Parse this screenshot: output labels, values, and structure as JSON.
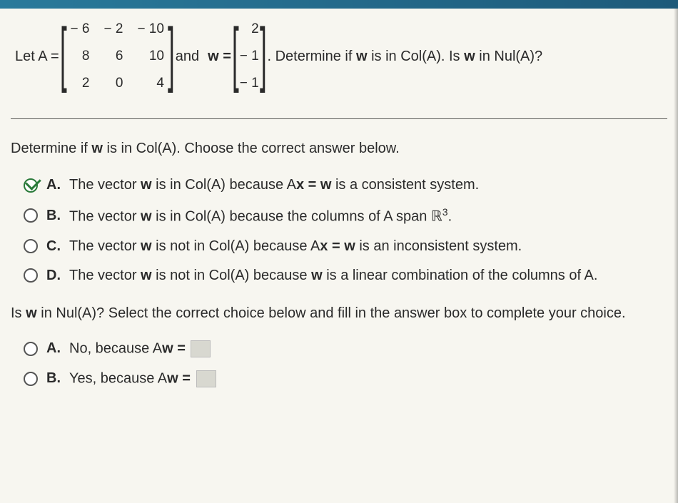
{
  "problem": {
    "let_a": "Let A =",
    "A": [
      [
        "− 6",
        "− 2",
        "− 10"
      ],
      [
        "8",
        "6",
        "10"
      ],
      [
        "2",
        "0",
        "4"
      ]
    ],
    "and_w": "and",
    "w_eq": "w =",
    "w": [
      [
        "2"
      ],
      [
        "− 1"
      ],
      [
        "− 1"
      ]
    ],
    "tail": ". Determine if",
    "tail2": "is in Col(A). Is",
    "tail3": "in Nul(A)?",
    "w_bold": "w"
  },
  "q1": {
    "prompt_pre": "Determine if",
    "prompt_mid": "is in Col(A). Choose the correct answer below.",
    "options": {
      "A": {
        "letter": "A.",
        "pre": "The vector",
        "mid": "is in Col(A) because A",
        "post": "is a consistent system.",
        "eq": "x = w"
      },
      "B": {
        "letter": "B.",
        "pre": "The vector",
        "mid": "is in Col(A) because the columns of A span ℝ",
        "sup": "3",
        "post": "."
      },
      "C": {
        "letter": "C.",
        "pre": "The vector",
        "mid": "is not in Col(A) because A",
        "post": "is an inconsistent system.",
        "eq": "x = w"
      },
      "D": {
        "letter": "D.",
        "pre": "The vector",
        "mid": "is not in Col(A) because",
        "post": "is a linear combination of the columns of A."
      }
    }
  },
  "q2": {
    "prompt_pre": "Is",
    "prompt_post": "in Nul(A)? Select the correct choice below and fill in the answer box to complete your choice.",
    "options": {
      "A": {
        "letter": "A.",
        "text": "No, because A",
        "eq": "w ="
      },
      "B": {
        "letter": "B.",
        "text": "Yes, because A",
        "eq": "w ="
      }
    }
  }
}
